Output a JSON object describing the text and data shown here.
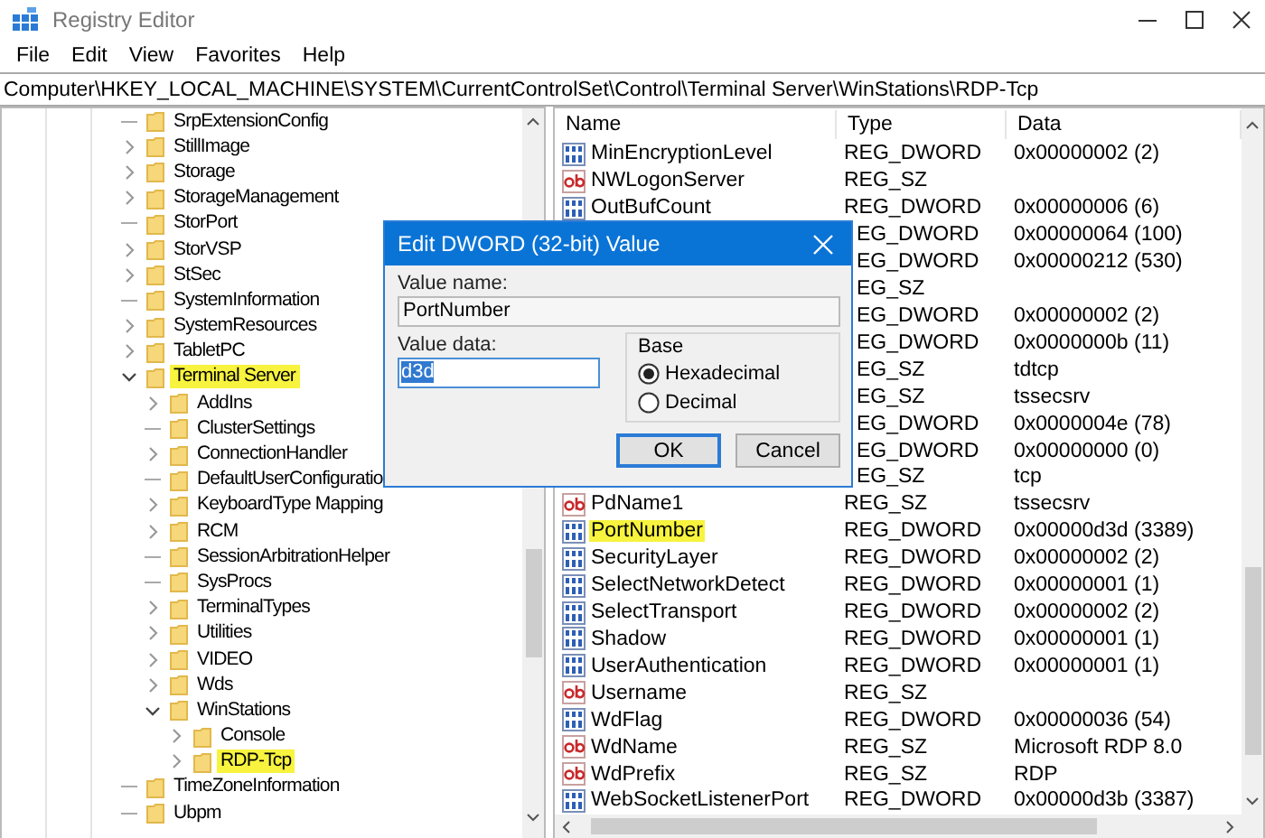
{
  "window": {
    "title": "Registry Editor"
  },
  "menu": [
    "File",
    "Edit",
    "View",
    "Favorites",
    "Help"
  ],
  "address": "Computer\\HKEY_LOCAL_MACHINE\\SYSTEM\\CurrentControlSet\\Control\\Terminal Server\\WinStations\\RDP-Tcp",
  "tree": {
    "items": [
      {
        "label": "SrpExtensionConfig",
        "kind": "leaf",
        "highlighted": false
      },
      {
        "label": "StillImage",
        "kind": "branch",
        "expanded": false,
        "highlighted": false
      },
      {
        "label": "Storage",
        "kind": "branch",
        "expanded": false,
        "highlighted": false
      },
      {
        "label": "StorageManagement",
        "kind": "branch",
        "expanded": false,
        "highlighted": false
      },
      {
        "label": "StorPort",
        "kind": "leaf",
        "highlighted": false
      },
      {
        "label": "StorVSP",
        "kind": "branch",
        "expanded": false,
        "highlighted": false
      },
      {
        "label": "StSec",
        "kind": "branch",
        "expanded": false,
        "highlighted": false
      },
      {
        "label": "SystemInformation",
        "kind": "leaf",
        "highlighted": false
      },
      {
        "label": "SystemResources",
        "kind": "branch",
        "expanded": false,
        "highlighted": false
      },
      {
        "label": "TabletPC",
        "kind": "branch",
        "expanded": false,
        "highlighted": false
      },
      {
        "label": "Terminal Server",
        "kind": "branch",
        "expanded": true,
        "highlighted": true,
        "children": [
          {
            "label": "AddIns",
            "kind": "branch",
            "expanded": false,
            "highlighted": false
          },
          {
            "label": "ClusterSettings",
            "kind": "leaf",
            "highlighted": false
          },
          {
            "label": "ConnectionHandler",
            "kind": "branch",
            "expanded": false,
            "highlighted": false
          },
          {
            "label": "DefaultUserConfiguratio",
            "kind": "leaf",
            "highlighted": false
          },
          {
            "label": "KeyboardType Mapping",
            "kind": "branch",
            "expanded": false,
            "highlighted": false
          },
          {
            "label": "RCM",
            "kind": "branch",
            "expanded": false,
            "highlighted": false
          },
          {
            "label": "SessionArbitrationHelper",
            "kind": "leaf",
            "highlighted": false
          },
          {
            "label": "SysProcs",
            "kind": "leaf",
            "highlighted": false
          },
          {
            "label": "TerminalTypes",
            "kind": "branch",
            "expanded": false,
            "highlighted": false
          },
          {
            "label": "Utilities",
            "kind": "branch",
            "expanded": false,
            "highlighted": false
          },
          {
            "label": "VIDEO",
            "kind": "branch",
            "expanded": false,
            "highlighted": false
          },
          {
            "label": "Wds",
            "kind": "branch",
            "expanded": false,
            "highlighted": false
          },
          {
            "label": "WinStations",
            "kind": "branch",
            "expanded": true,
            "highlighted": false,
            "children": [
              {
                "label": "Console",
                "kind": "branch",
                "expanded": false,
                "highlighted": false
              },
              {
                "label": "RDP-Tcp",
                "kind": "branch",
                "expanded": false,
                "highlighted": true
              }
            ]
          }
        ]
      },
      {
        "label": "TimeZoneInformation",
        "kind": "leaf",
        "highlighted": false
      },
      {
        "label": "Ubpm",
        "kind": "leaf",
        "highlighted": false
      }
    ]
  },
  "values": {
    "columns": [
      "Name",
      "Type",
      "Data"
    ],
    "rows": [
      {
        "kind": "dword",
        "name": "MinEncryptionLevel",
        "type": "REG_DWORD",
        "data": "0x00000002 (2)",
        "highlighted": false
      },
      {
        "kind": "sz",
        "name": "NWLogonServer",
        "type": "REG_SZ",
        "highlighted": false
      },
      {
        "kind": "dword",
        "name": "OutBufCount",
        "type": "REG_DWORD",
        "data": "0x00000006 (6)",
        "highlighted": false
      },
      {
        "kind": "covered",
        "type": "EG_DWORD",
        "data": "0x00000064 (100)"
      },
      {
        "kind": "covered",
        "type": "EG_DWORD",
        "data": "0x00000212 (530)"
      },
      {
        "kind": "covered",
        "type": "EG_SZ"
      },
      {
        "kind": "covered",
        "type": "EG_DWORD",
        "data": "0x00000002 (2)"
      },
      {
        "kind": "covered",
        "type": "EG_DWORD",
        "data": "0x0000000b (11)"
      },
      {
        "kind": "covered",
        "type": "EG_SZ",
        "data": "tdtcp"
      },
      {
        "kind": "covered",
        "type": "EG_SZ",
        "data": "tssecsrv"
      },
      {
        "kind": "covered",
        "type": "EG_DWORD",
        "data": "0x0000004e (78)"
      },
      {
        "kind": "covered",
        "type": "EG_DWORD",
        "data": "0x00000000 (0)"
      },
      {
        "kind": "covered",
        "type": "EG_SZ",
        "data": "tcp"
      },
      {
        "kind": "sz",
        "name": "PdName1",
        "type": "REG_SZ",
        "data": "tssecsrv",
        "highlighted": false
      },
      {
        "kind": "dword",
        "name": "PortNumber",
        "type": "REG_DWORD",
        "data": "0x00000d3d (3389)",
        "highlighted": true
      },
      {
        "kind": "dword",
        "name": "SecurityLayer",
        "type": "REG_DWORD",
        "data": "0x00000002 (2)",
        "highlighted": false
      },
      {
        "kind": "dword",
        "name": "SelectNetworkDetect",
        "type": "REG_DWORD",
        "data": "0x00000001 (1)",
        "highlighted": false
      },
      {
        "kind": "dword",
        "name": "SelectTransport",
        "type": "REG_DWORD",
        "data": "0x00000002 (2)",
        "highlighted": false
      },
      {
        "kind": "dword",
        "name": "Shadow",
        "type": "REG_DWORD",
        "data": "0x00000001 (1)",
        "highlighted": false
      },
      {
        "kind": "dword",
        "name": "UserAuthentication",
        "type": "REG_DWORD",
        "data": "0x00000001 (1)",
        "highlighted": false
      },
      {
        "kind": "sz",
        "name": "Username",
        "type": "REG_SZ",
        "highlighted": false
      },
      {
        "kind": "dword",
        "name": "WdFlag",
        "type": "REG_DWORD",
        "data": "0x00000036 (54)",
        "highlighted": false
      },
      {
        "kind": "sz",
        "name": "WdName",
        "type": "REG_SZ",
        "data": "Microsoft RDP 8.0",
        "highlighted": false
      },
      {
        "kind": "sz",
        "name": "WdPrefix",
        "type": "REG_SZ",
        "data": "RDP",
        "highlighted": false
      },
      {
        "kind": "dword",
        "name": "WebSocketListenerPort",
        "type": "REG_DWORD",
        "data": "0x00000d3b (3387)",
        "highlighted": false
      }
    ]
  },
  "dialog": {
    "title": "Edit DWORD (32-bit) Value",
    "value_name_label": "Value name:",
    "value_name": "PortNumber",
    "value_data_label": "Value data:",
    "value_data": "d3d",
    "value_data_selected": true,
    "base_label": "Base",
    "bases": [
      {
        "label": "Hexadecimal",
        "selected": true
      },
      {
        "label": "Decimal",
        "selected": false
      }
    ],
    "buttons": [
      {
        "label": "OK",
        "default": true
      },
      {
        "label": "Cancel",
        "default": false
      }
    ]
  }
}
